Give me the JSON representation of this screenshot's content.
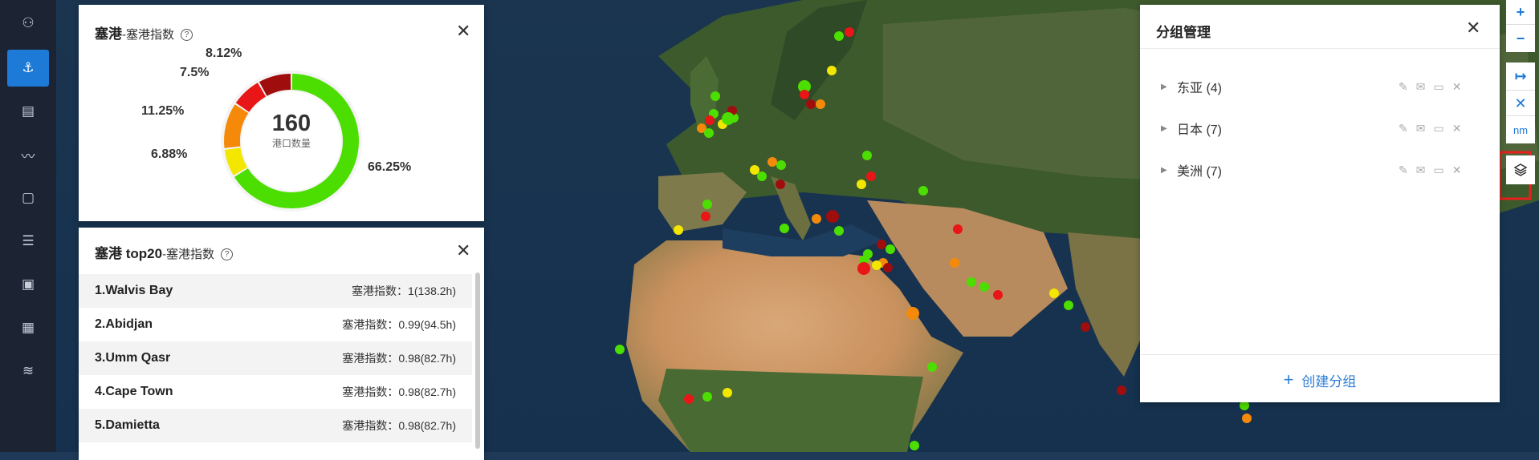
{
  "sidebar": {
    "items": [
      {
        "icon": "ship-user-icon",
        "glyph": "⚇"
      },
      {
        "icon": "anchor-icon",
        "glyph": "⚓",
        "active": true
      },
      {
        "icon": "document-list-icon",
        "glyph": "▤"
      },
      {
        "icon": "route-icon",
        "glyph": "〰"
      },
      {
        "icon": "file-icon",
        "glyph": "▢"
      },
      {
        "icon": "database-icon",
        "glyph": "☰"
      },
      {
        "icon": "box-settings-icon",
        "glyph": "▣"
      },
      {
        "icon": "calendar-grid-icon",
        "glyph": "▦"
      },
      {
        "icon": "wave-icon",
        "glyph": "≋"
      }
    ]
  },
  "donut_panel": {
    "title": "塞港",
    "subtitle": "-塞港指数",
    "help": "?",
    "close": "✕",
    "center_value": "160",
    "center_caption": "港口数量",
    "segments": [
      {
        "label": "66.25%",
        "value": 66.25,
        "color": "#4cde00"
      },
      {
        "label": "6.88%",
        "value": 6.88,
        "color": "#f3e700"
      },
      {
        "label": "11.25%",
        "value": 11.25,
        "color": "#f58a0a"
      },
      {
        "label": "7.5%",
        "value": 7.5,
        "color": "#e81616"
      },
      {
        "label": "8.12%",
        "value": 8.12,
        "color": "#a00d0d"
      }
    ]
  },
  "top20_panel": {
    "title": "塞港 top20",
    "subtitle": "-塞港指数",
    "help": "?",
    "close": "✕",
    "rows": [
      {
        "name": "1.Walvis Bay",
        "value": "塞港指数：1(138.2h)"
      },
      {
        "name": "2.Abidjan",
        "value": "塞港指数：0.99(94.5h)"
      },
      {
        "name": "3.Umm Qasr",
        "value": "塞港指数：0.98(82.7h)"
      },
      {
        "name": "4.Cape Town",
        "value": "塞港指数：0.98(82.7h)"
      },
      {
        "name": "5.Damietta",
        "value": "塞港指数：0.98(82.7h)"
      }
    ]
  },
  "group_panel": {
    "title": "分组管理",
    "close": "✕",
    "groups": [
      {
        "label": "东亚 (4)"
      },
      {
        "label": "日本 (7)"
      },
      {
        "label": "美洲 (7)"
      }
    ],
    "create_label": "创建分组"
  },
  "toolbar": {
    "zoom_in": "+",
    "zoom_out": "−",
    "measure": "↦",
    "clear": "✕",
    "unit": "nm",
    "layers_icon": "layers-icon"
  },
  "colors": {
    "accent": "#1d7ad6",
    "annotation": "#e8201e",
    "status_green": "#4cde00",
    "status_yellow": "#f3e700",
    "status_orange": "#f58a0a",
    "status_red": "#e81616",
    "status_darkred": "#a00d0d"
  }
}
